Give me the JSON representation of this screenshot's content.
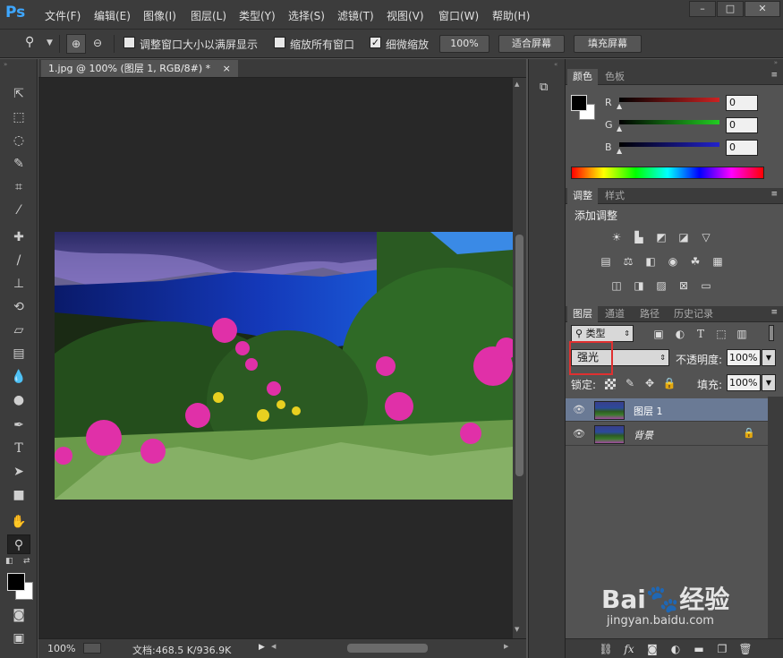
{
  "app": {
    "logo": "Ps"
  },
  "menu": [
    "文件(F)",
    "编辑(E)",
    "图像(I)",
    "图层(L)",
    "类型(Y)",
    "选择(S)",
    "滤镜(T)",
    "视图(V)",
    "窗口(W)",
    "帮助(H)"
  ],
  "window_controls": {
    "minimize": "–",
    "maximize": "□",
    "close": "✕"
  },
  "options": {
    "resize_windows": "调整窗口大小以满屏显示",
    "zoom_all": "缩放所有窗口",
    "scrubby_zoom": "细微缩放",
    "scrubby_zoom_checked": true,
    "btn_100": "100%",
    "btn_fit": "适合屏幕",
    "btn_fill": "填充屏幕"
  },
  "document": {
    "tab_title": "1.jpg @ 100% (图层 1, RGB/8#) *",
    "tab_close": "×",
    "zoom": "100%",
    "doc_info": "文档:468.5 K/936.9K"
  },
  "color_panel": {
    "tabs": [
      "颜色",
      "色板"
    ],
    "channels": [
      {
        "label": "R",
        "value": "0",
        "gradient": "#cc2222"
      },
      {
        "label": "G",
        "value": "0",
        "gradient": "#22cc22"
      },
      {
        "label": "B",
        "value": "0",
        "gradient": "#2222cc"
      }
    ]
  },
  "adjust_panel": {
    "tabs": [
      "调整",
      "样式"
    ],
    "title": "添加调整"
  },
  "layers_panel": {
    "tabs": [
      "图层",
      "通道",
      "路径",
      "历史记录"
    ],
    "filter_kind": "类型",
    "blend_mode": "强光",
    "opacity_label": "不透明度:",
    "opacity": "100%",
    "lock_label": "锁定:",
    "fill_label": "填充:",
    "fill": "100%",
    "layers": [
      {
        "name": "图层 1",
        "selected": true,
        "locked": false
      },
      {
        "name": "背景",
        "selected": false,
        "locked": true
      }
    ]
  },
  "watermark": {
    "brand": "Bai",
    "brand2": "经验",
    "url": "jingyan.baidu.com"
  }
}
